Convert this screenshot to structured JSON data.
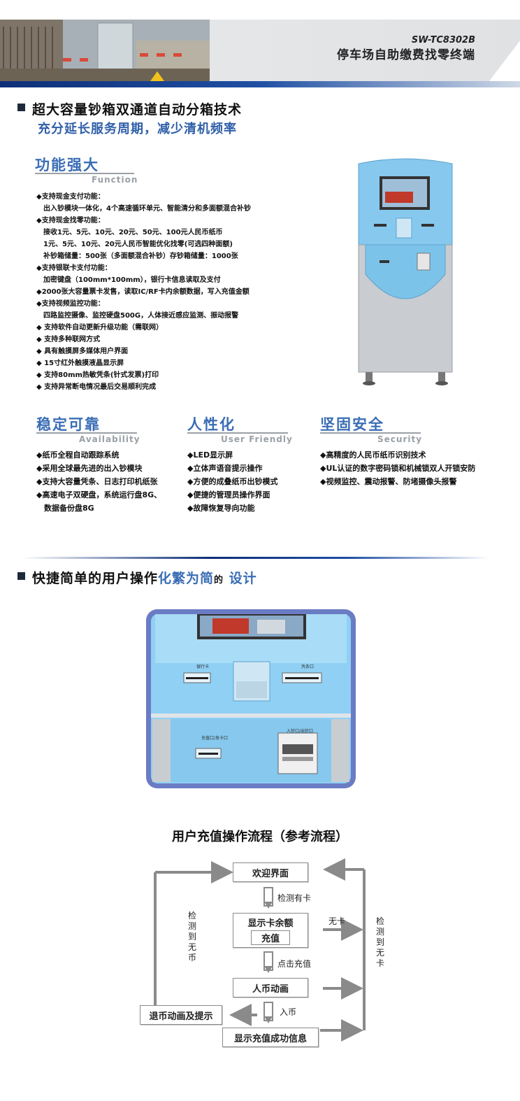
{
  "header": {
    "model": "SW-TC8302B",
    "product": "停车场自助缴费找零终端"
  },
  "section1": {
    "title": "超大容量钞箱双通道自动分箱技术",
    "subtitle": "充分延长服务周期，减少清机频率"
  },
  "function": {
    "title": "功能强大",
    "subtitle": "Function",
    "lines": [
      "◆支持现金支付功能：",
      "　出入钞模块一体化，4个高速循环单元、智能清分和多面额混合补钞",
      "◆支持现金找零功能：",
      "　接收1元、5元、10元、20元、50元、100元人民币纸币",
      "　1元、5元、10元、20元人民币智能优化找零(可选四种面额)",
      "　补钞箱储量：500张（多面额混合补钞）存钞箱储量：1000张",
      "◆支持银联卡支付功能：",
      "　加密键盘（100mm*100mm），银行卡信息读取及支付",
      "◆2000张大容量票卡发售，读取IC/RF卡内余额数据，写入充值金额",
      "◆支持视频监控功能：",
      "　四路监控摄像、监控硬盘500G，人体接近感应监测、振动报警",
      "◆ 支持软件自动更新升级功能（需联网）",
      "◆ 支持多种联网方式",
      "◆ 具有触摸屏多媒体用户界面",
      "◆ 15寸红外触摸液晶显示屏",
      "◆ 支持80mm热敏凭条(针式发票)打印",
      "◆ 支持异常断电情况最后交易顺利完成"
    ]
  },
  "availability": {
    "title": "稳定可靠",
    "subtitle": "Availability",
    "lines": [
      "◆纸币全程自动跟踪系统",
      "◆采用全球最先进的出入钞模块",
      "◆支持大容量凭条、日志打印机纸张",
      "◆高速电子双硬盘，系统运行盘8G、",
      "　数据备份盘8G"
    ]
  },
  "friendly": {
    "title": "人性化",
    "subtitle": "User Friendly",
    "lines": [
      "◆LED显示屏",
      "◆立体声语音提示操作",
      "◆方便的成叠纸币出钞模式",
      "◆便捷的管理员操作界面",
      "◆故障恢复导向功能"
    ]
  },
  "security": {
    "title": "坚固安全",
    "subtitle": "Security",
    "lines": [
      "◆高精度的人民币纸币识别技术",
      "◆UL认证的数字密码锁和机械锁双人开锁安防",
      "◆视频监控、震动报警、防堵摄像头报警"
    ]
  },
  "section2": {
    "title_a": "快捷简单的用户操作",
    "title_b": "化繁为简",
    "title_c": "的",
    "title_d": "设计"
  },
  "panel": {
    "bank_card": "银行卡",
    "receipt": "凭条口",
    "card_slot": "充值口/发卡口",
    "cash_slot": "入钞口/出钞口"
  },
  "flow": {
    "title": "用户充值操作流程（参考流程）",
    "welcome": "欢迎界面",
    "detect_card": "检测有卡",
    "show_balance": "显示卡余额",
    "recharge": "充值",
    "no_card": "无卡",
    "click_recharge": "点击充值",
    "insert_anim": "人币动画",
    "insert_cash": "入币",
    "return_anim": "退币动画及提示",
    "success": "显示充值成功信息",
    "left_label": "检测到无币",
    "right_label": "检测到无卡"
  },
  "colors": {
    "accent": "#3a6db5",
    "kiosk": "#7cc3ea",
    "navy": "#0e2f77"
  }
}
